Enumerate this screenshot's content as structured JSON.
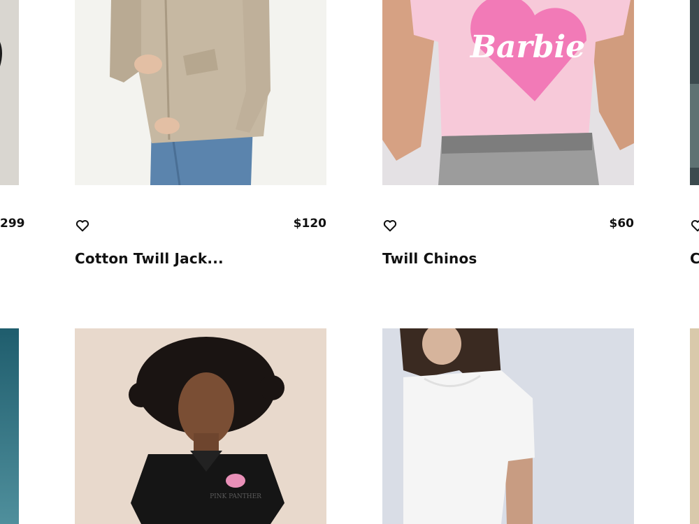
{
  "row1": {
    "left_partial": {
      "price": "299"
    },
    "card1": {
      "title": "Cotton Twill Jack...",
      "price": "$120",
      "image": "beige-zip-jacket-photo"
    },
    "card2": {
      "title": "Twill Chinos",
      "price": "$60",
      "image": "barbie-pink-tee-photo",
      "print_text": "Barbie"
    },
    "right_partial": {
      "title_fragment": "C"
    }
  },
  "row2": {
    "card1": {
      "image": "child-black-polo-photo",
      "print_text": "PINK PANTHER"
    },
    "card2": {
      "image": "white-tee-photo"
    }
  },
  "colors": {
    "text": "#111111",
    "background": "#ffffff",
    "barbie_pink": "#f27ab7"
  }
}
